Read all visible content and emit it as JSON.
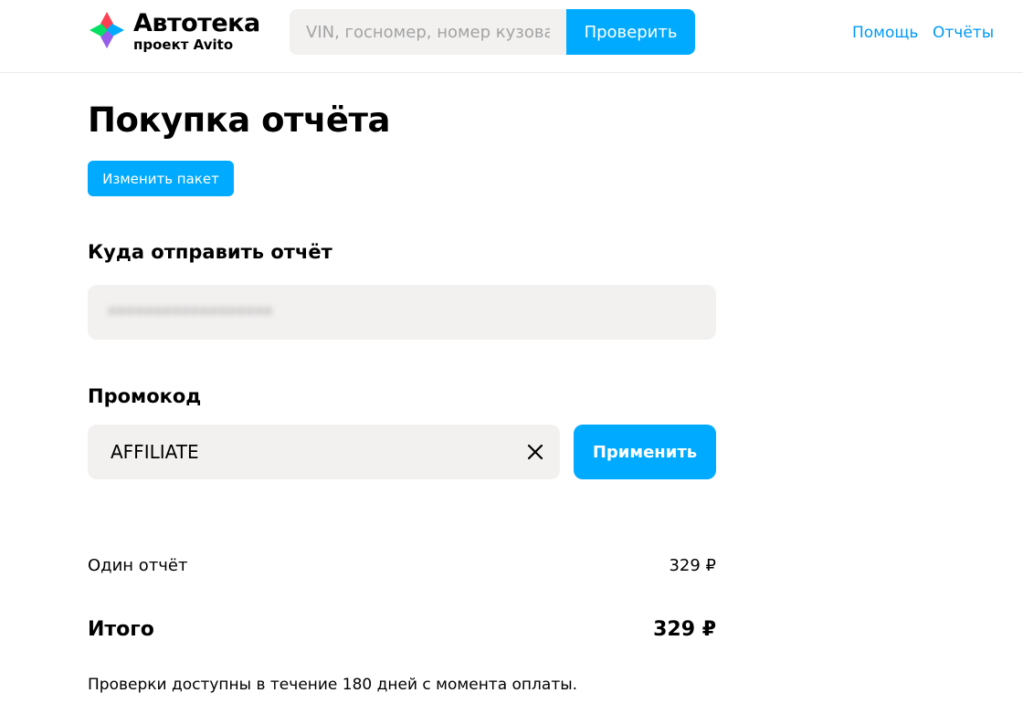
{
  "header": {
    "logo_name": "Автотека",
    "logo_sub": "проект Avito",
    "search_placeholder": "VIN, госномер, номер кузова",
    "search_button": "Проверить",
    "nav": [
      {
        "label": "Помощь"
      },
      {
        "label": "Отчёты"
      }
    ]
  },
  "main": {
    "title": "Покупка отчёта",
    "change_package_button": "Изменить пакет",
    "email_section_title": "Куда отправить отчёт",
    "email_value": "••••••••••••••••••",
    "promo_section_title": "Промокод",
    "promo_value": "AFFILIATE",
    "apply_button": "Применить",
    "line_item_label": "Один отчёт",
    "line_item_price": "329 ₽",
    "total_label": "Итого",
    "total_price": "329 ₽",
    "note": "Проверки доступны в течение 180 дней с момента оплаты."
  },
  "colors": {
    "accent": "#00aaff",
    "link": "#0099f7",
    "field_bg": "#f2f1f0"
  }
}
